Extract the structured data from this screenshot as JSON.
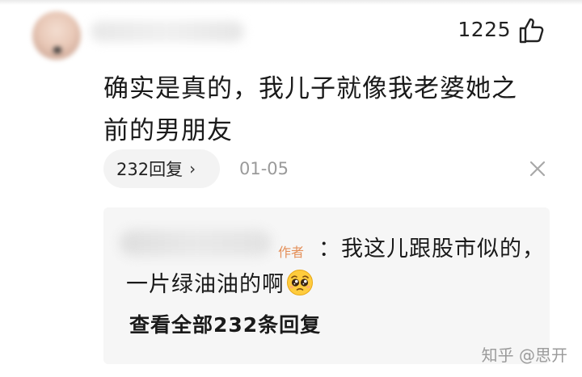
{
  "comment": {
    "likes": "1225",
    "text": "确实是真的，我儿子就像我老婆她之前的男朋友",
    "reply_count_label": "232回复",
    "reply_chevron": "›",
    "date": "01-05"
  },
  "reply_preview": {
    "author_tag": "作者",
    "text": "：我这儿跟股市似的，一片绿油油的啊",
    "emoji": "pleading-face-emoji",
    "view_all_label": "查看全部232条回复"
  },
  "watermark": "知乎 @思开",
  "icons": {
    "like": "thumbs-up-icon",
    "close": "close-icon"
  },
  "colors": {
    "author_tag": "#e4905a",
    "date": "#9a9a9a",
    "reply_bg": "#f6f6f6",
    "chip_bg": "#f3f3f3"
  }
}
